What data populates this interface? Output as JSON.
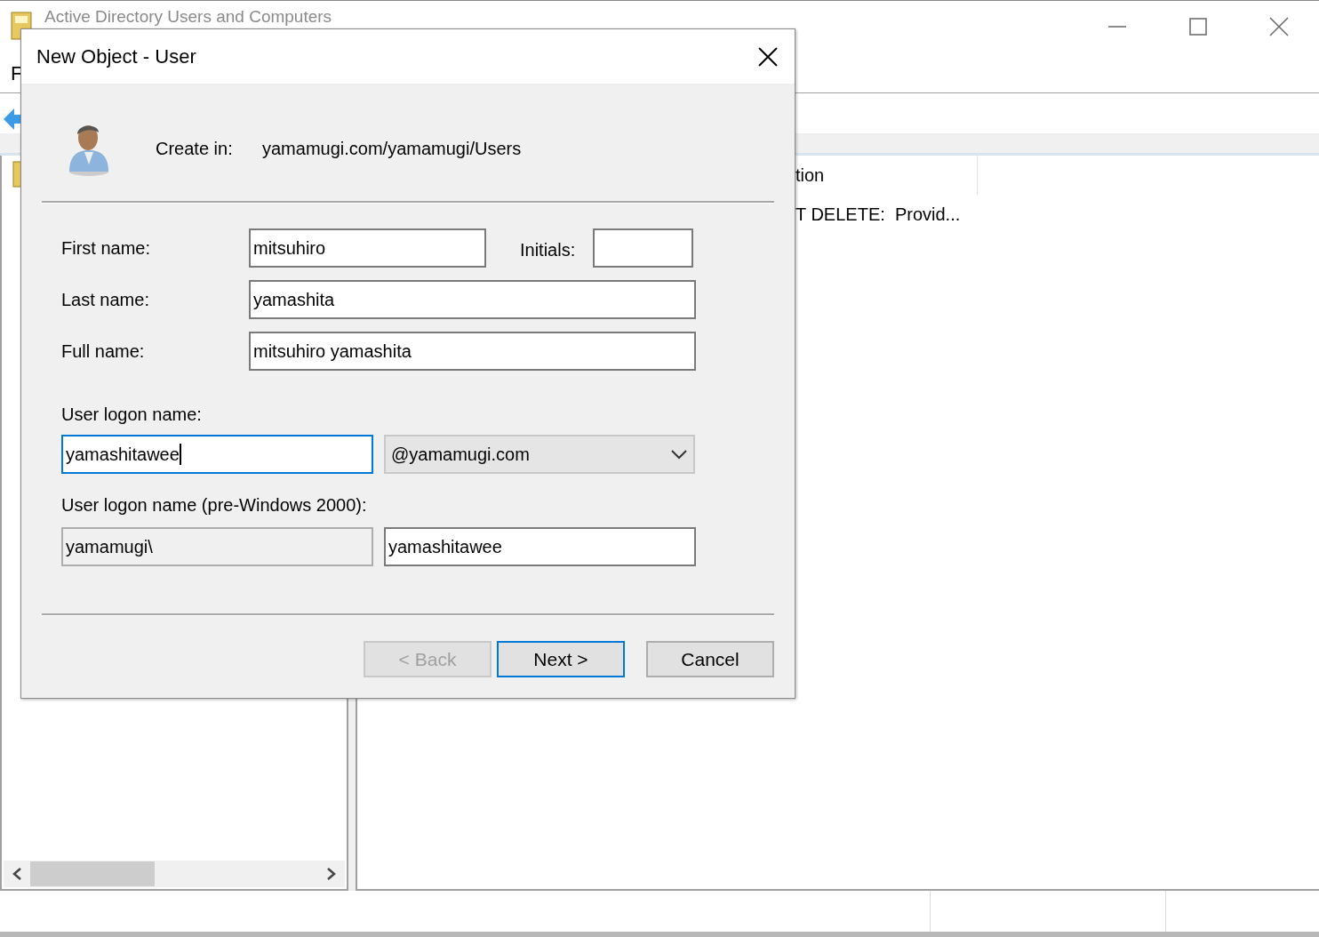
{
  "window": {
    "title": "Active Directory Users and Computers"
  },
  "menu": [
    "F"
  ],
  "list": {
    "columns": [
      "tion"
    ],
    "rows": [
      [
        "T DELETE:  Provid..."
      ]
    ]
  },
  "dialog": {
    "title": "New Object - User",
    "create_in_label": "Create in:",
    "create_in_path": "yamamugi.com/yamamugi/Users",
    "first_name": {
      "label": "First name:",
      "value": "mitsuhiro"
    },
    "initials": {
      "label": "Initials:"
    },
    "last_name": {
      "label": "Last name:",
      "value": "yamashita"
    },
    "full_name": {
      "label": "Full name:",
      "value": "mitsuhiro yamashita"
    },
    "logon_name": {
      "label": "User logon name:",
      "value": "yamashitawee",
      "focused": true
    },
    "upn_suffix": {
      "value": "@yamamugi.com"
    },
    "pre2000": {
      "label": "User logon name (pre-Windows 2000):",
      "domain": "yamamugi\\",
      "domain_disabled": true,
      "value": "yamashitawee"
    },
    "buttons": [
      {
        "label": "< Back",
        "disabled": true,
        "default": false
      },
      {
        "label": "Next >",
        "disabled": false,
        "default": true
      },
      {
        "label": "Cancel",
        "disabled": false,
        "default": false
      }
    ]
  }
}
